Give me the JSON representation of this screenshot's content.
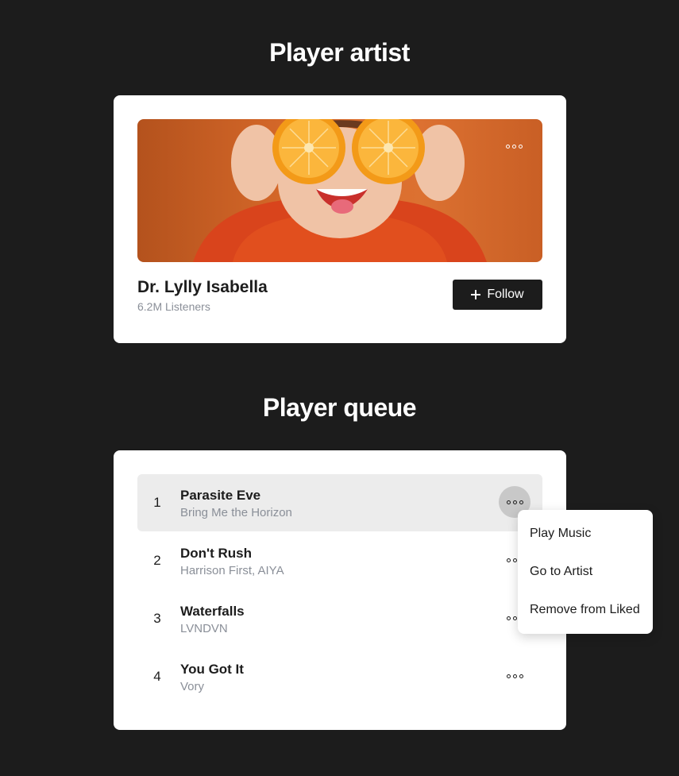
{
  "artist_section": {
    "title": "Player artist",
    "artist_name": "Dr. Lylly Isabella",
    "listeners": "6.2M Listeners",
    "follow_label": "Follow",
    "banner_more_icon": "more-horizontal-icon"
  },
  "queue_section": {
    "title": "Player queue",
    "tracks": [
      {
        "number": "1",
        "title": "Parasite Eve",
        "artist": "Bring Me the Horizon",
        "active": true
      },
      {
        "number": "2",
        "title": "Don't Rush",
        "artist": "Harrison First, AIYA",
        "active": false
      },
      {
        "number": "3",
        "title": "Waterfalls",
        "artist": "LVNDVN",
        "active": false
      },
      {
        "number": "4",
        "title": "You Got It",
        "artist": "Vory",
        "active": false
      }
    ]
  },
  "context_menu": {
    "items": [
      {
        "label": "Play Music"
      },
      {
        "label": "Go to Artist"
      },
      {
        "label": "Remove from Liked"
      }
    ]
  },
  "colors": {
    "background": "#1c1c1c",
    "card": "#ffffff",
    "muted_text": "#8a8f98",
    "active_row": "#ececec",
    "banner_orange": "#d86a2a"
  }
}
